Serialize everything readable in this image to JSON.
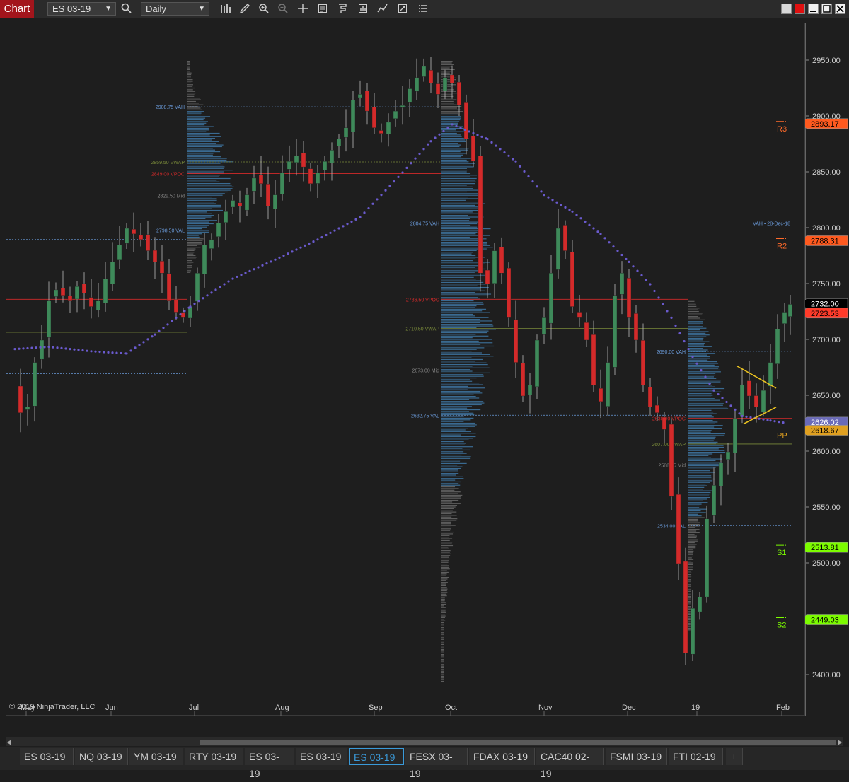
{
  "toolbar": {
    "chart_label": "Chart",
    "instrument": "ES 03-19",
    "interval": "Daily",
    "icons": [
      "search-icon",
      "bar-style-icon",
      "drawing-tools-icon",
      "zoom-in-icon",
      "zoom-out-icon",
      "crosshair-icon",
      "data-box-icon",
      "indicators-icon",
      "strategies-icon",
      "chart-trader-icon",
      "properties-icon",
      "templates-icon"
    ]
  },
  "chart": {
    "copyright": "© 2019 NinjaTrader, LLC",
    "x_labels": [
      "May",
      "Jun",
      "Jul",
      "Aug",
      "Sep",
      "Oct",
      "Nov",
      "Dec",
      "19",
      "Feb"
    ],
    "y_ticks": [
      "2950.00",
      "2900.00",
      "2850.00",
      "2800.00",
      "2750.00",
      "2700.00",
      "2650.00",
      "2600.00",
      "2550.00",
      "2500.00",
      "2450.00",
      "2400.00"
    ],
    "price_markers": [
      {
        "value": "2893.17",
        "color": "#ff5a1f",
        "fg": "#000"
      },
      {
        "value": "2788.31",
        "color": "#ff5a1f",
        "fg": "#000"
      },
      {
        "value": "2732.00",
        "color": "#000000",
        "fg": "#ffffff"
      },
      {
        "value": "2723.53",
        "color": "#ff3b2a",
        "fg": "#000"
      },
      {
        "value": "2626.02",
        "color": "#6a6ab8",
        "fg": "#ffffff"
      },
      {
        "value": "2618.67",
        "color": "#e0a020",
        "fg": "#000"
      },
      {
        "value": "2513.81",
        "color": "#7cfc00",
        "fg": "#000"
      },
      {
        "value": "2449.03",
        "color": "#7cfc00",
        "fg": "#000"
      }
    ],
    "pivots": [
      {
        "label": "R3",
        "color": "#ff6a2a"
      },
      {
        "label": "R2",
        "color": "#ff6a2a"
      },
      {
        "label": "PP",
        "color": "#e0a020"
      },
      {
        "label": "S1",
        "color": "#7cfc00"
      },
      {
        "label": "S2",
        "color": "#7cfc00"
      }
    ],
    "profile1": {
      "vah": "2908.75 VAH",
      "vwap": "2859.50 VWAP",
      "vpoc": "2849.00 VPOC",
      "mid": "2829.50 Mid",
      "val": "2798.50 VAL"
    },
    "profile2": {
      "vah": "2804.75 VAH",
      "vpoc": "2736.50 VPOC",
      "vwap": "2710.50 VWAP",
      "mid": "2673.00 Mid",
      "val": "2632.75 VAL"
    },
    "profile3": {
      "vah": "2690.00 VAH",
      "vpoc": "2630.00 VPOC",
      "vwap": "2607.00 VWAP",
      "mid": "2588.25 Mid",
      "val": "2534.00 VAL"
    },
    "prior_vah": "VAH • 28-Dec-18",
    "colors": {
      "up": "#3e8a5a",
      "down": "#d42a2a",
      "vwap_dots": "#6a5acd",
      "profile": "#4a7fa8",
      "vah": "#6a9ad9",
      "vpoc": "#d42a2a",
      "vwap": "#7a8a3a"
    }
  },
  "tabs": [
    "ES 03-19",
    "NQ 03-19",
    "YM 03-19",
    "RTY 03-19",
    "ES 03-19",
    "ES 03-19",
    "ES 03-19",
    "FESX 03-19",
    "FDAX 03-19",
    "CAC40 02-19",
    "FSMI 03-19",
    "FTI 02-19"
  ],
  "active_tab_index": 6,
  "add_tab": "+"
}
